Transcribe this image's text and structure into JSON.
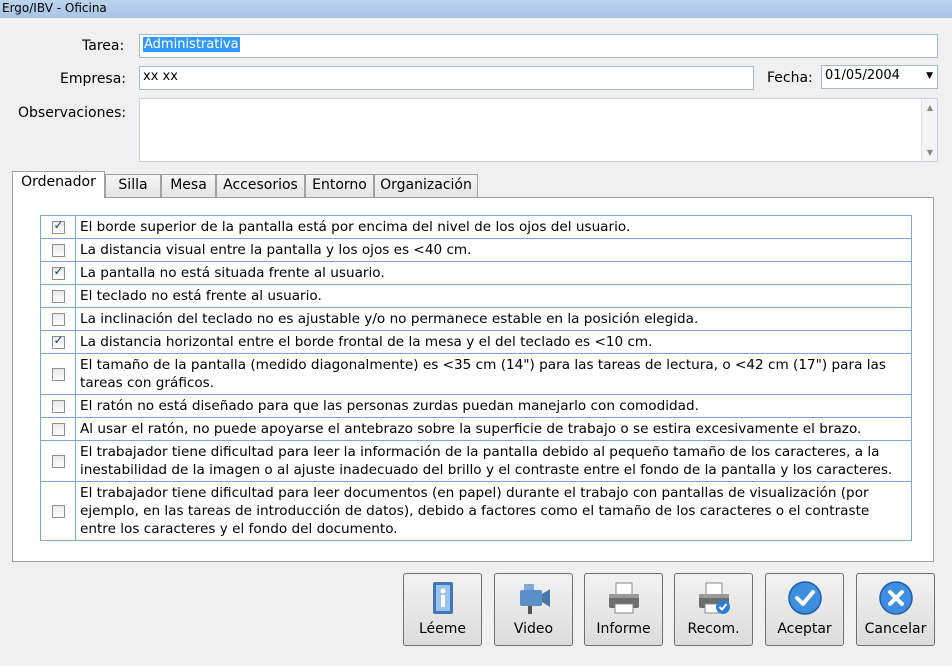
{
  "window": {
    "title": "Ergo/IBV - Oficina"
  },
  "form": {
    "tarea_label": "Tarea:",
    "tarea_value": "Administrativa",
    "empresa_label": "Empresa:",
    "empresa_value": "xx xx",
    "fecha_label": "Fecha:",
    "fecha_value": "01/05/2004",
    "observaciones_label": "Observaciones:",
    "observaciones_value": ""
  },
  "tabs": [
    {
      "label": "Ordenador",
      "active": true
    },
    {
      "label": "Silla",
      "active": false
    },
    {
      "label": "Mesa",
      "active": false
    },
    {
      "label": "Accesorios",
      "active": false
    },
    {
      "label": "Entorno",
      "active": false
    },
    {
      "label": "Organización",
      "active": false
    }
  ],
  "checklist": [
    {
      "text": "El borde superior de la pantalla está por encima del nivel de los ojos del usuario.",
      "checked": true
    },
    {
      "text": "La distancia visual entre la pantalla y los ojos es <40 cm.",
      "checked": false
    },
    {
      "text": "La pantalla no está situada frente al usuario.",
      "checked": true
    },
    {
      "text": "El teclado no está frente al usuario.",
      "checked": false
    },
    {
      "text": "La inclinación del teclado no es ajustable y/o no permanece estable en la posición elegida.",
      "checked": false
    },
    {
      "text": "La distancia horizontal entre el borde frontal de la mesa y el del teclado es <10 cm.",
      "checked": true
    },
    {
      "text": "El tamaño de la pantalla (medido diagonalmente) es <35 cm (14\") para las tareas de lectura, o <42 cm (17\") para las tareas con gráficos.",
      "checked": false
    },
    {
      "text": "El ratón no está diseñado para que las personas zurdas puedan manejarlo con comodidad.",
      "checked": false
    },
    {
      "text": "Al usar el ratón, no puede apoyarse el antebrazo sobre la superficie de trabajo o se estira excesivamente el brazo.",
      "checked": false
    },
    {
      "text": "El trabajador tiene dificultad para leer la información de la pantalla debido al pequeño tamaño de los caracteres, a la inestabilidad de la imagen o al ajuste inadecuado del brillo y el contraste entre el fondo de la pantalla y los caracteres.",
      "checked": false
    },
    {
      "text": "El trabajador tiene dificultad para leer documentos (en papel) durante el trabajo con pantallas de visualización (por ejemplo, en las tareas de introducción de datos), debido a factores como el tamaño de los caracteres o el contraste entre los caracteres y el fondo del documento.",
      "checked": false
    }
  ],
  "buttons": [
    {
      "label": "Léeme",
      "icon": "readme-icon"
    },
    {
      "label": "Video",
      "icon": "video-camera-icon"
    },
    {
      "label": "Informe",
      "icon": "printer-icon"
    },
    {
      "label": "Recom.",
      "icon": "printer-check-icon"
    },
    {
      "label": "Aceptar",
      "icon": "accept-check-icon"
    },
    {
      "label": "Cancelar",
      "icon": "cancel-x-icon"
    }
  ]
}
